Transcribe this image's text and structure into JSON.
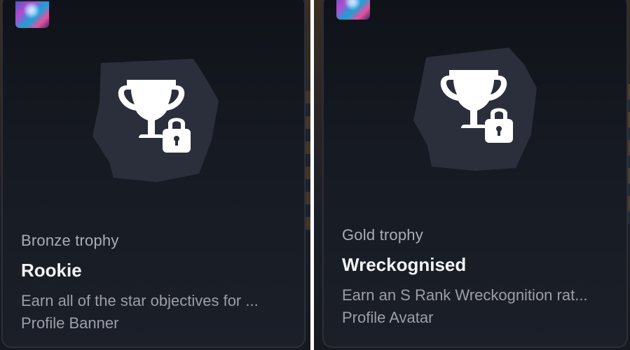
{
  "cards": [
    {
      "grade": "Bronze trophy",
      "name": "Rookie",
      "description": "Earn all of the star objectives for ...",
      "reward": "Profile Banner",
      "locked": true,
      "icon": "trophy-locked-icon"
    },
    {
      "grade": "Gold trophy",
      "name": "Wreckognised",
      "description": "Earn an S Rank Wreckognition rat...",
      "reward": "Profile Avatar",
      "locked": true,
      "icon": "trophy-locked-icon"
    }
  ],
  "colors": {
    "card_background": "#161a22",
    "grade_text": "#a9adb6",
    "name_text": "#f2f3f5",
    "desc_text": "#9c9fa7",
    "icon_plate": "#2a2f3b",
    "icon_fill": "#ffffff"
  }
}
